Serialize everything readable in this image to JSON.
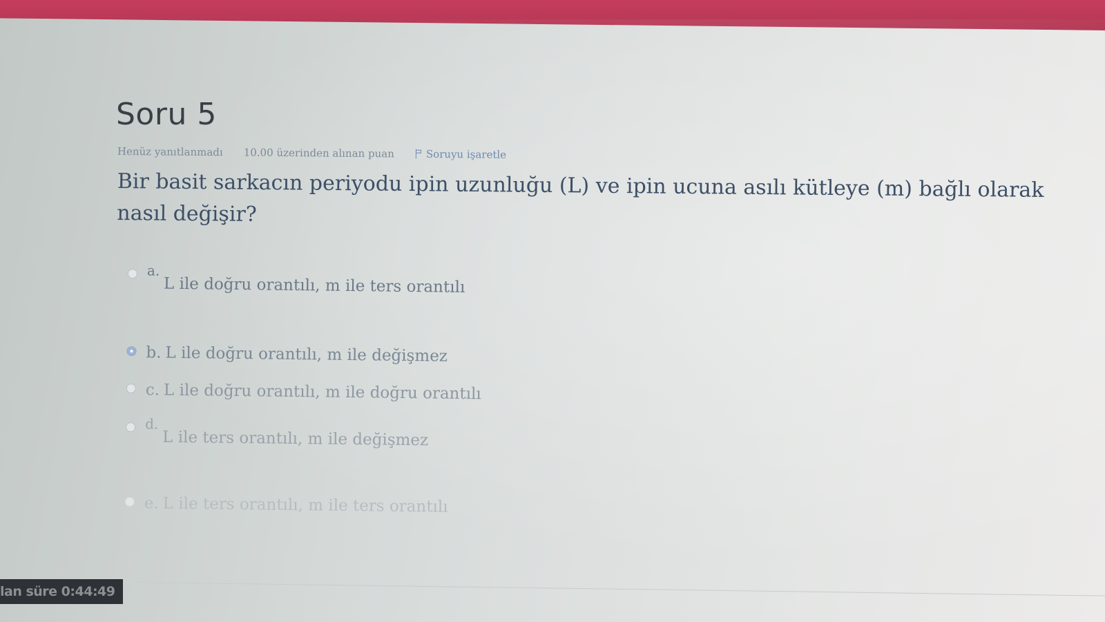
{
  "question": {
    "title": "Soru 5",
    "status": "Henüz yanıtlanmadı",
    "points": "10.00 üzerinden alınan puan",
    "flag_label": "Soruyu işaretle",
    "text": "Bir basit sarkacın periyodu ipin uzunluğu (L) ve ipin ucuna asılı kütleye (m) bağlı olarak nasıl değişir?"
  },
  "answers": [
    {
      "letter": "a.",
      "text": "L ile doğru orantılı, m ile ters orantılı",
      "selected": false
    },
    {
      "letter": "b.",
      "text": "L ile doğru orantılı, m ile değişmez",
      "selected": true
    },
    {
      "letter": "c.",
      "text": "L ile doğru orantılı, m ile doğru orantılı",
      "selected": false
    },
    {
      "letter": "d.",
      "text": "L ile ters orantılı, m ile değişmez",
      "selected": false
    },
    {
      "letter": "e.",
      "text": "L ile ters orantılı, m ile ters orantılı",
      "selected": false
    }
  ],
  "timer": {
    "text": "lan süre 0:44:49"
  },
  "colors": {
    "header": "#c63d5e",
    "link": "#6d8bb0"
  },
  "icons": {
    "flag": "flag-icon",
    "radio": "radio-button-icon"
  }
}
